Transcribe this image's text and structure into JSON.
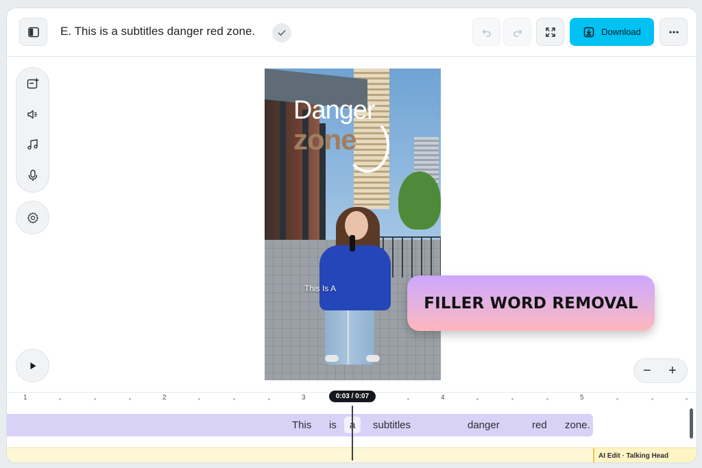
{
  "header": {
    "title": "E. This is a subtitles danger red zone.",
    "download_label": "Download",
    "accent_color": "#00c2f2"
  },
  "video": {
    "headline_line1": "Danger",
    "headline_line2": "zone",
    "caption": "This Is A"
  },
  "overlay": {
    "filler_label": "FILLER WORD REMOVAL"
  },
  "zoom": {
    "minus": "−",
    "plus": "+"
  },
  "timeline": {
    "timecode": "0:03 / 0:07",
    "ruler_labels": [
      "1",
      "2",
      "3",
      "4",
      "5"
    ],
    "words": [
      "This",
      "is",
      "a",
      "subtitles",
      "danger",
      "red",
      "zone."
    ],
    "ai_track_label": "AI Edit · Talking Head"
  },
  "icons": {
    "sidebar_toggle": "sidebar-toggle-icon",
    "check": "check-icon",
    "undo": "undo-icon",
    "redo": "redo-icon",
    "fullscreen": "fullscreen-icon",
    "download": "download-icon",
    "more": "more-icon",
    "media": "add-media-icon",
    "audio": "volume-icon",
    "music": "music-icon",
    "mic": "microphone-icon",
    "settings": "gear-icon",
    "play": "play-icon"
  }
}
